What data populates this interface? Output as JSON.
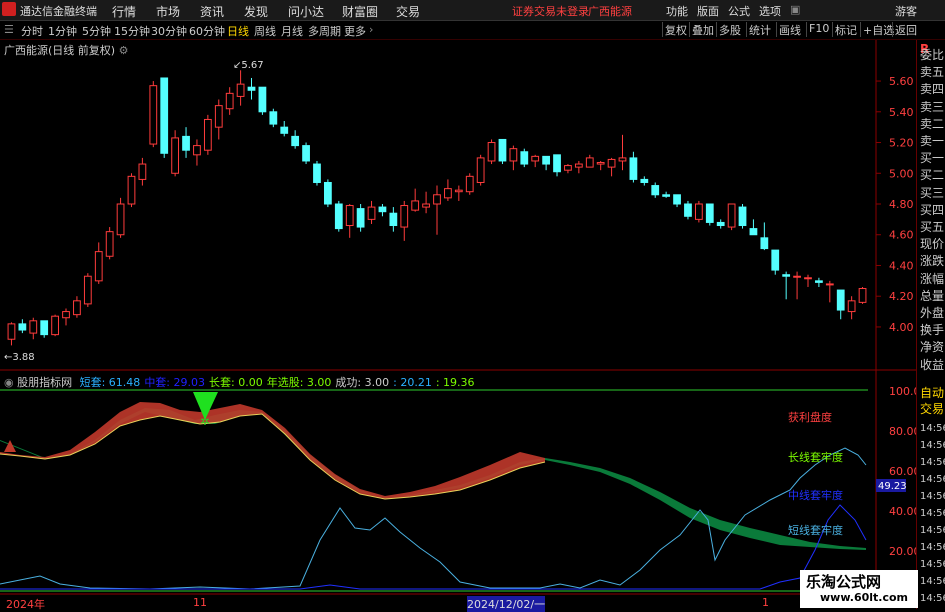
{
  "topbar": {
    "app_title": "通达信金融终端",
    "menus": [
      "行情",
      "市场",
      "资讯",
      "发现",
      "问小达",
      "财富圈",
      "交易"
    ],
    "warning": "证券交易未登录",
    "stock": "广西能源",
    "right_menus": [
      "功能",
      "版面",
      "公式",
      "选项"
    ],
    "guest": "游客"
  },
  "periods": {
    "items": [
      "分时",
      "1分钟",
      "5分钟",
      "15分钟",
      "30分钟",
      "60分钟",
      "日线",
      "周线",
      "月线",
      "多周期",
      "更多"
    ],
    "active": "日线",
    "tools": [
      "复权",
      "叠加",
      "多股",
      "统计",
      "画线",
      "F10",
      "标记",
      "+自选",
      "返回"
    ]
  },
  "chart": {
    "label": "广西能源(日线 前复权)",
    "high_marker": "5.67",
    "low_marker": "3.88",
    "price_axis": [
      "5.60",
      "5.40",
      "5.20",
      "5.00",
      "4.80",
      "4.60",
      "4.40",
      "4.20",
      "4.00"
    ],
    "colors": {
      "up": "#ff3c3c",
      "down": "#54ffff"
    }
  },
  "indicator": {
    "name": "股朋指标网",
    "values": [
      {
        "label": "短套:",
        "value": "61.48",
        "color": "#2ab0ff"
      },
      {
        "label": "中套:",
        "value": "29.03",
        "color": "#2020ff"
      },
      {
        "label": "长套:",
        "value": "0.00",
        "color": "#7cfc00"
      },
      {
        "label": "年选股:",
        "value": "3.00",
        "color": "#7cfc00"
      },
      {
        "label": "成功:",
        "value": "3.00",
        "color": "#ccc"
      },
      {
        "label": ":",
        "value": "20.21",
        "color": "#2ab0ff"
      },
      {
        "label": ":",
        "value": "19.36",
        "color": "#7cfc00"
      }
    ],
    "axis": [
      "100.0",
      "80.00",
      "60.00",
      "40.00",
      "20.00"
    ],
    "current_value": "49.23",
    "annotations": {
      "profit": "获利盘度",
      "long": "长线套牢度",
      "mid": "中线套牢度",
      "short": "短线套牢度"
    }
  },
  "right_panel": {
    "items": [
      "委比",
      "卖五",
      "卖四",
      "卖三",
      "卖二",
      "卖一",
      "买一",
      "买二",
      "买三",
      "买四",
      "买五",
      "现价",
      "涨跌",
      "涨幅",
      "总量",
      "外盘",
      "换手",
      "净资",
      "收益",
      "自动",
      "交易",
      "14:56",
      "14:56",
      "14:56",
      "14:56",
      "14:56",
      "14:56",
      "14:56",
      "14:56",
      "14:56",
      "14:56",
      "14:56"
    ]
  },
  "date_axis": {
    "labels": [
      "2024年",
      "11",
      "2024/12/02/一",
      "1"
    ]
  },
  "watermark": {
    "line1": "乐淘公式网",
    "line2": "www.60lt.com"
  },
  "chart_data": {
    "type": "candlestick",
    "title": "广西能源(日线 前复权)",
    "ylim": [
      3.85,
      5.75
    ],
    "candles": [
      [
        3.92,
        4.03,
        3.88,
        4.02
      ],
      [
        4.02,
        4.05,
        3.96,
        3.98
      ],
      [
        3.96,
        4.06,
        3.92,
        4.04
      ],
      [
        4.04,
        4.04,
        3.93,
        3.95
      ],
      [
        3.95,
        4.08,
        3.94,
        4.07
      ],
      [
        4.06,
        4.12,
        4.01,
        4.1
      ],
      [
        4.08,
        4.2,
        4.06,
        4.17
      ],
      [
        4.15,
        4.35,
        4.13,
        4.33
      ],
      [
        4.3,
        4.55,
        4.28,
        4.49
      ],
      [
        4.46,
        4.65,
        4.44,
        4.62
      ],
      [
        4.6,
        4.84,
        4.58,
        4.8
      ],
      [
        4.8,
        5.0,
        4.78,
        4.98
      ],
      [
        4.96,
        5.1,
        4.92,
        5.06
      ],
      [
        5.19,
        5.6,
        5.17,
        5.57
      ],
      [
        5.62,
        5.62,
        5.1,
        5.13
      ],
      [
        5.0,
        5.28,
        4.98,
        5.23
      ],
      [
        5.24,
        5.3,
        5.1,
        5.15
      ],
      [
        5.12,
        5.22,
        5.05,
        5.18
      ],
      [
        5.15,
        5.38,
        5.12,
        5.35
      ],
      [
        5.3,
        5.48,
        5.22,
        5.44
      ],
      [
        5.42,
        5.56,
        5.38,
        5.52
      ],
      [
        5.5,
        5.67,
        5.44,
        5.58
      ],
      [
        5.56,
        5.62,
        5.48,
        5.54
      ],
      [
        5.56,
        5.56,
        5.38,
        5.4
      ],
      [
        5.4,
        5.42,
        5.3,
        5.32
      ],
      [
        5.3,
        5.34,
        5.24,
        5.26
      ],
      [
        5.24,
        5.28,
        5.16,
        5.18
      ],
      [
        5.18,
        5.2,
        5.06,
        5.08
      ],
      [
        5.06,
        5.08,
        4.92,
        4.94
      ],
      [
        4.94,
        4.96,
        4.78,
        4.8
      ],
      [
        4.8,
        4.82,
        4.62,
        4.64
      ],
      [
        4.66,
        4.8,
        4.58,
        4.79
      ],
      [
        4.77,
        4.8,
        4.62,
        4.65
      ],
      [
        4.7,
        4.82,
        4.67,
        4.78
      ],
      [
        4.78,
        4.8,
        4.72,
        4.75
      ],
      [
        4.74,
        4.78,
        4.62,
        4.66
      ],
      [
        4.65,
        4.82,
        4.56,
        4.79
      ],
      [
        4.76,
        4.9,
        4.75,
        4.82
      ],
      [
        4.78,
        4.88,
        4.74,
        4.8
      ],
      [
        4.8,
        4.92,
        4.6,
        4.86
      ],
      [
        4.84,
        4.96,
        4.82,
        4.9
      ],
      [
        4.88,
        4.92,
        4.82,
        4.89
      ],
      [
        4.88,
        5.0,
        4.86,
        4.98
      ],
      [
        4.94,
        5.12,
        4.92,
        5.1
      ],
      [
        5.08,
        5.22,
        5.06,
        5.2
      ],
      [
        5.22,
        5.22,
        5.06,
        5.08
      ],
      [
        5.08,
        5.18,
        5.02,
        5.16
      ],
      [
        5.14,
        5.16,
        5.04,
        5.06
      ],
      [
        5.08,
        5.12,
        5.04,
        5.11
      ],
      [
        5.11,
        5.11,
        5.02,
        5.06
      ],
      [
        5.12,
        5.12,
        4.98,
        5.01
      ],
      [
        5.02,
        5.06,
        5.0,
        5.05
      ],
      [
        5.04,
        5.08,
        5.0,
        5.06
      ],
      [
        5.04,
        5.12,
        5.04,
        5.1
      ],
      [
        5.06,
        5.08,
        5.02,
        5.07
      ],
      [
        5.04,
        5.1,
        4.98,
        5.09
      ],
      [
        5.08,
        5.25,
        5.02,
        5.1
      ],
      [
        5.1,
        5.14,
        4.94,
        4.96
      ],
      [
        4.96,
        4.98,
        4.92,
        4.94
      ],
      [
        4.92,
        4.94,
        4.84,
        4.86
      ],
      [
        4.86,
        4.88,
        4.84,
        4.85
      ],
      [
        4.86,
        4.86,
        4.78,
        4.8
      ],
      [
        4.8,
        4.82,
        4.7,
        4.72
      ],
      [
        4.7,
        4.82,
        4.68,
        4.8
      ],
      [
        4.8,
        4.8,
        4.66,
        4.68
      ],
      [
        4.68,
        4.7,
        4.64,
        4.66
      ],
      [
        4.65,
        4.8,
        4.63,
        4.8
      ],
      [
        4.78,
        4.8,
        4.64,
        4.66
      ],
      [
        4.64,
        4.7,
        4.6,
        4.6
      ],
      [
        4.58,
        4.68,
        4.5,
        4.51
      ],
      [
        4.5,
        4.5,
        4.34,
        4.37
      ],
      [
        4.34,
        4.36,
        4.18,
        4.33
      ],
      [
        4.33,
        4.36,
        4.18,
        4.33
      ],
      [
        4.32,
        4.34,
        4.26,
        4.32
      ],
      [
        4.3,
        4.32,
        4.26,
        4.29
      ],
      [
        4.28,
        4.3,
        4.16,
        4.28
      ],
      [
        4.24,
        4.24,
        4.05,
        4.11
      ],
      [
        4.1,
        4.2,
        4.05,
        4.17
      ],
      [
        4.16,
        4.26,
        4.15,
        4.25
      ]
    ]
  }
}
